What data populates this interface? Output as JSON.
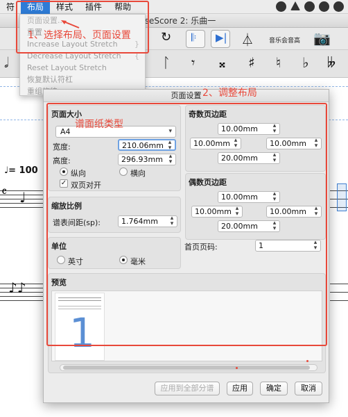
{
  "menubar": {
    "items": [
      "符",
      "布局",
      "样式",
      "插件",
      "帮助"
    ]
  },
  "window": {
    "title": "MuseScore 2: 乐曲一"
  },
  "toolbar": {
    "concert_pitch_label": "音乐会音高"
  },
  "layout_menu": {
    "items": [
      {
        "label": "页面设置...",
        "shortcut": ""
      },
      {
        "label": "重置",
        "shortcut": ""
      },
      {
        "label": "Increase Layout Stretch",
        "shortcut": "}"
      },
      {
        "label": "Decrease Layout Stretch",
        "shortcut": "{"
      },
      {
        "label": "Reset Layout Stretch",
        "shortcut": ""
      },
      {
        "label": "恢复默认符杠",
        "shortcut": ""
      },
      {
        "label": "重组旋律",
        "shortcut": ""
      }
    ]
  },
  "score": {
    "tempo_text": "♩= 100"
  },
  "dialog": {
    "title": "页面设置",
    "page_size": {
      "title": "页面大小",
      "paper": "A4",
      "width_label": "宽度:",
      "width_value": "210.06mm",
      "height_label": "高度:",
      "height_value": "296.93mm",
      "portrait": "纵向",
      "landscape": "横向",
      "two_sided": "双页对开"
    },
    "odd_margins": {
      "title": "奇数页边距",
      "top": "10.00mm",
      "left": "10.00mm",
      "right": "10.00mm",
      "bottom": "20.00mm"
    },
    "even_margins": {
      "title": "偶数页边距",
      "top": "10.00mm",
      "left": "10.00mm",
      "right": "10.00mm",
      "bottom": "20.00mm"
    },
    "scaling": {
      "title": "缩放比例",
      "spacing_label": "谱表间距(sp):",
      "spacing_value": "1.764mm"
    },
    "units": {
      "title": "单位",
      "inch": "英寸",
      "mm": "毫米"
    },
    "first_page": {
      "label": "首页页码:",
      "value": "1"
    },
    "preview": {
      "title": "预览",
      "page_number": "1"
    },
    "buttons": {
      "apply_all": "应用到全部分谱",
      "apply": "应用",
      "ok": "确定",
      "cancel": "取消"
    }
  },
  "annotations": {
    "step1": "1、选择布局、页面设置",
    "step2": "2、调整布局",
    "paper_type": "谱面纸类型",
    "color": "#e8483a"
  }
}
